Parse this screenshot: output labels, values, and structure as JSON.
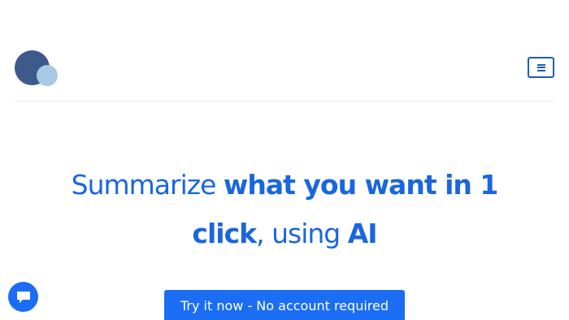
{
  "header": {
    "logo_icon": "two-circles-logo",
    "menu_icon": "hamburger-icon"
  },
  "hero": {
    "part1": "Summarize ",
    "part2": "what you want in 1 click",
    "part3": ", using ",
    "part4": "AI"
  },
  "cta": {
    "label": "Try it now - No account required"
  },
  "chat": {
    "icon": "chat-bubble-icon"
  },
  "colors": {
    "accent": "#1b6ef3",
    "headline": "#1a66e0",
    "logo_dark": "#3d5a8a",
    "logo_light": "#a9c8e3"
  }
}
